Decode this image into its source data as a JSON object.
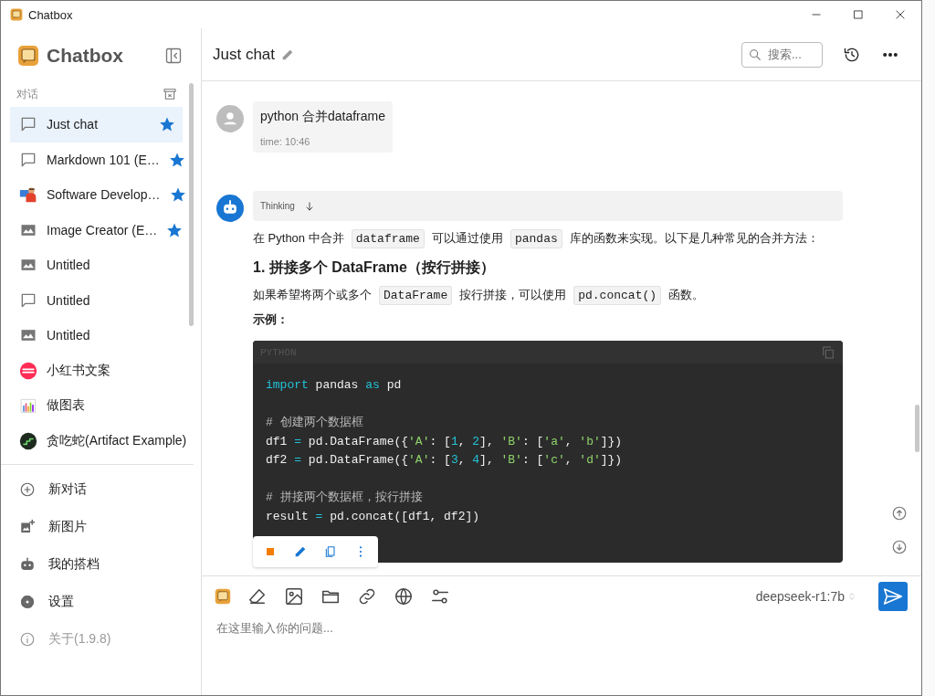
{
  "window": {
    "title": "Chatbox"
  },
  "sidebar": {
    "app_name": "Chatbox",
    "section_label": "对话",
    "sessions": [
      {
        "title": "Just chat",
        "kind": "chat",
        "starred": true,
        "selected": true
      },
      {
        "title": "Markdown 101 (E…",
        "kind": "chat",
        "starred": true,
        "selected": false
      },
      {
        "title": "Software Develop…",
        "kind": "developer",
        "starred": true,
        "selected": false
      },
      {
        "title": "Image Creator (E…",
        "kind": "image",
        "starred": true,
        "selected": false
      },
      {
        "title": "Untitled",
        "kind": "image",
        "starred": false,
        "selected": false
      },
      {
        "title": "Untitled",
        "kind": "chat",
        "starred": false,
        "selected": false
      },
      {
        "title": "Untitled",
        "kind": "image",
        "starred": false,
        "selected": false
      },
      {
        "title": "小红书文案",
        "kind": "badge",
        "starred": false,
        "selected": false
      },
      {
        "title": "做图表",
        "kind": "chart",
        "starred": false,
        "selected": false
      },
      {
        "title": "贪吃蛇(Artifact Example)",
        "kind": "snake",
        "starred": false,
        "selected": false
      }
    ],
    "menu": [
      {
        "label": "新对话",
        "kind": "new-chat",
        "disabled": false
      },
      {
        "label": "新图片",
        "kind": "new-image",
        "disabled": false
      },
      {
        "label": "我的搭档",
        "kind": "partners",
        "disabled": false
      },
      {
        "label": "设置",
        "kind": "settings",
        "disabled": false
      },
      {
        "label": "关于(1.9.8)",
        "kind": "about",
        "disabled": true
      }
    ]
  },
  "header": {
    "title": "Just chat",
    "search": {
      "placeholder": "搜索..."
    }
  },
  "messages": [
    {
      "kind": "user",
      "text": "python 合并dataframe",
      "time": "time: 10:46"
    },
    {
      "kind": "assistant",
      "thinking": "Thinking",
      "blocks": [
        {
          "kind": "paragraph",
          "parts": [
            {
              "kind": "text",
              "text": "在 Python 中合并"
            },
            {
              "kind": "code",
              "text": "dataframe"
            },
            {
              "kind": "text",
              "text": "可以通过使用"
            },
            {
              "kind": "code",
              "text": "pandas"
            },
            {
              "kind": "text",
              "text": "库的函数来实现。以下是几种常见的合并方法："
            }
          ]
        },
        {
          "kind": "heading",
          "text": "1. 拼接多个 DataFrame（按行拼接）"
        },
        {
          "kind": "paragraph",
          "parts": [
            {
              "kind": "text",
              "text": "如果希望将两个或多个"
            },
            {
              "kind": "code",
              "text": "DataFrame"
            },
            {
              "kind": "text",
              "text": "按行拼接，可以使用"
            },
            {
              "kind": "code",
              "text": "pd.concat()"
            },
            {
              "kind": "text",
              "text": "函数。"
            }
          ]
        },
        {
          "kind": "label",
          "text": "示例："
        },
        {
          "kind": "code",
          "language": "PYTHON",
          "lines": [
            {
              "kind": "code",
              "tokens": [
                {
                  "text": "import",
                  "kind": "keyword"
                },
                {
                  "text": " pandas ",
                  "kind": "plain"
                },
                {
                  "text": "as",
                  "kind": "keyword"
                },
                {
                  "text": " pd",
                  "kind": "plain"
                }
              ]
            },
            {
              "kind": "blank"
            },
            {
              "kind": "code",
              "tokens": [
                {
                  "text": "# 创建两个数据框",
                  "kind": "comment"
                }
              ]
            },
            {
              "kind": "code",
              "tokens": [
                {
                  "text": "df1 ",
                  "kind": "plain"
                },
                {
                  "text": "=",
                  "kind": "operator"
                },
                {
                  "text": " pd.DataFrame({",
                  "kind": "plain"
                },
                {
                  "text": "'A'",
                  "kind": "string"
                },
                {
                  "text": ": [",
                  "kind": "plain"
                },
                {
                  "text": "1",
                  "kind": "number"
                },
                {
                  "text": ", ",
                  "kind": "plain"
                },
                {
                  "text": "2",
                  "kind": "number"
                },
                {
                  "text": "], ",
                  "kind": "plain"
                },
                {
                  "text": "'B'",
                  "kind": "string"
                },
                {
                  "text": ": [",
                  "kind": "plain"
                },
                {
                  "text": "'a'",
                  "kind": "string"
                },
                {
                  "text": ", ",
                  "kind": "plain"
                },
                {
                  "text": "'b'",
                  "kind": "string"
                },
                {
                  "text": "]})",
                  "kind": "plain"
                }
              ]
            },
            {
              "kind": "code",
              "tokens": [
                {
                  "text": "df2 ",
                  "kind": "plain"
                },
                {
                  "text": "=",
                  "kind": "operator"
                },
                {
                  "text": " pd.DataFrame({",
                  "kind": "plain"
                },
                {
                  "text": "'A'",
                  "kind": "string"
                },
                {
                  "text": ": [",
                  "kind": "plain"
                },
                {
                  "text": "3",
                  "kind": "number"
                },
                {
                  "text": ", ",
                  "kind": "plain"
                },
                {
                  "text": "4",
                  "kind": "number"
                },
                {
                  "text": "], ",
                  "kind": "plain"
                },
                {
                  "text": "'B'",
                  "kind": "string"
                },
                {
                  "text": ": [",
                  "kind": "plain"
                },
                {
                  "text": "'c'",
                  "kind": "string"
                },
                {
                  "text": ", ",
                  "kind": "plain"
                },
                {
                  "text": "'d'",
                  "kind": "string"
                },
                {
                  "text": "]})",
                  "kind": "plain"
                }
              ]
            },
            {
              "kind": "blank"
            },
            {
              "kind": "code",
              "tokens": [
                {
                  "text": "# 拼接两个数据框，按行拼接",
                  "kind": "comment"
                }
              ]
            },
            {
              "kind": "code",
              "tokens": [
                {
                  "text": "result ",
                  "kind": "plain"
                },
                {
                  "text": "=",
                  "kind": "operator"
                },
                {
                  "text": " pd.concat([df1, df2])",
                  "kind": "plain"
                }
              ]
            }
          ]
        }
      ]
    }
  ],
  "composer": {
    "model": "deepseek-r1:7b",
    "placeholder": "在这里输入你的问题..."
  }
}
